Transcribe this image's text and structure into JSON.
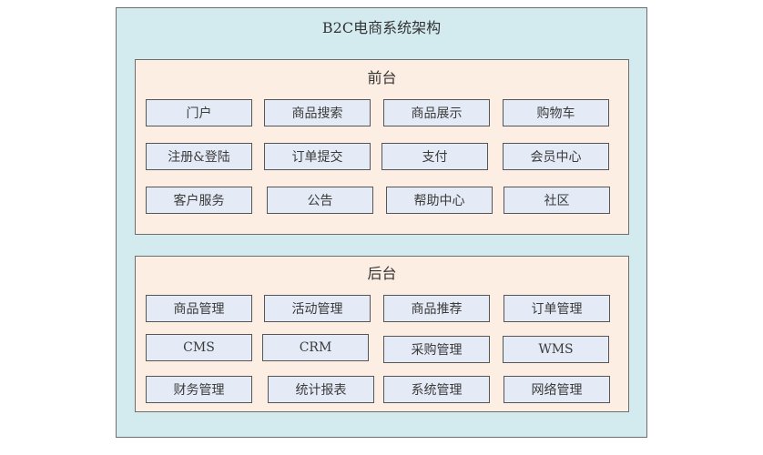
{
  "diagram": {
    "title": "B2C电商系统架构",
    "sections": [
      {
        "title": "前台",
        "rows": [
          [
            "门户",
            "商品搜索",
            "商品展示",
            "购物车"
          ],
          [
            "注册&登陆",
            "订单提交",
            "支付",
            "会员中心"
          ],
          [
            "客户服务",
            "公告",
            "帮助中心",
            "社区"
          ]
        ]
      },
      {
        "title": "后台",
        "rows": [
          [
            "商品管理",
            "活动管理",
            "商品推荐",
            "订单管理"
          ],
          [
            "CMS",
            "CRM",
            "采购管理",
            "WMS"
          ],
          [
            "财务管理",
            "统计报表",
            "系统管理",
            "网络管理"
          ]
        ]
      }
    ],
    "colors": {
      "outer_fill": "#d3ebef",
      "panel_fill": "#fdeee4",
      "box_fill": "#e4ebf6",
      "border": "#6e6e6e"
    }
  }
}
